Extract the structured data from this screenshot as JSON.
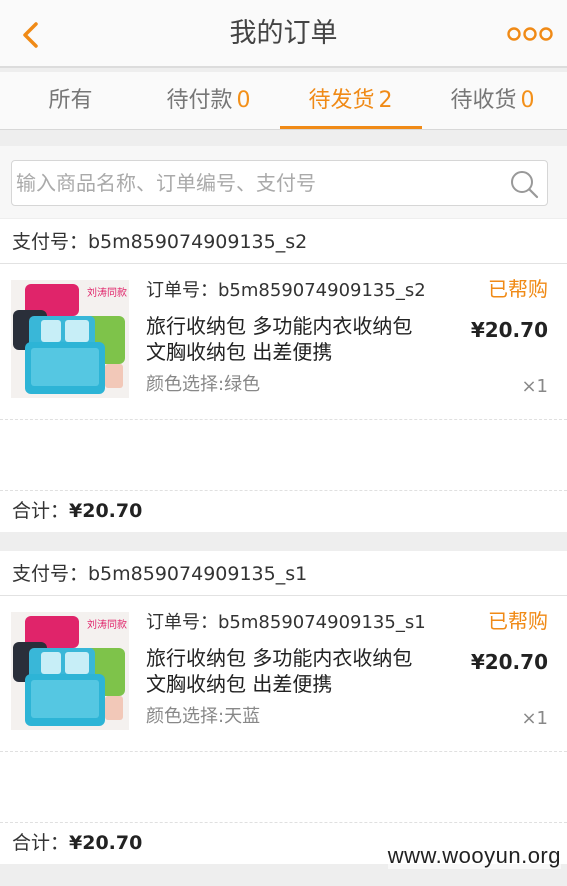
{
  "header": {
    "title": "我的订单",
    "back_icon": "chevron-left-icon",
    "more_icon": "more-dots-icon",
    "accent_color": "#f08a16"
  },
  "tabs": [
    {
      "label": "所有",
      "count": ""
    },
    {
      "label": "待付款",
      "count": "0"
    },
    {
      "label": "待发货",
      "count": "2",
      "active": true
    },
    {
      "label": "待收货",
      "count": "0"
    }
  ],
  "search": {
    "placeholder": "输入商品名称、订单编号、支付号",
    "value": ""
  },
  "orders": [
    {
      "pay_label": "支付号：b5m859074909135_s2",
      "order_label": "订单号：b5m859074909135_s2",
      "status": "已帮购",
      "product_title": "旅行收纳包 多功能内衣收纳包 文胸收纳包 出差便携",
      "price": "¥20.70",
      "spec": "颜色选择:绿色",
      "qty": "×1",
      "thumb_tag": "刘涛同款",
      "total_label": "合计：",
      "total_value": "¥20.70"
    },
    {
      "pay_label": "支付号：b5m859074909135_s1",
      "order_label": "订单号：b5m859074909135_s1",
      "status": "已帮购",
      "product_title": "旅行收纳包 多功能内衣收纳包 文胸收纳包 出差便携",
      "price": "¥20.70",
      "spec": "颜色选择:天蓝",
      "qty": "×1",
      "thumb_tag": "刘涛同款",
      "total_label": "合计：",
      "total_value": "¥20.70"
    }
  ],
  "watermark": "www.wooyun.org"
}
